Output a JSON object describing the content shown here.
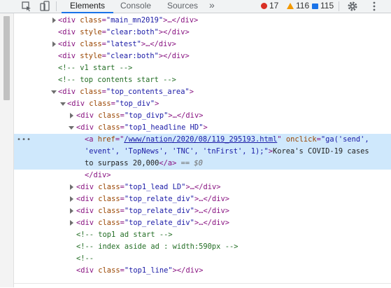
{
  "toolbar": {
    "tabs": [
      "Elements",
      "Console",
      "Sources"
    ],
    "more": "»",
    "errors": "17",
    "warnings": "116",
    "messages": "115",
    "colors": {
      "error": "#d93025",
      "warning": "#f29900",
      "message": "#1a73e8",
      "tab_underline": "#1a73e8"
    }
  },
  "dom": {
    "l1": {
      "open": "<div",
      "attr": "class",
      "val": "\"main_mn2019\"",
      "rest": ">…</div>"
    },
    "l2": {
      "open": "<div",
      "attr": "style",
      "val": "\"clear:both\"",
      "rest": "></div>"
    },
    "l3": {
      "open": "<div",
      "attr": "class",
      "val": "\"latest\"",
      "rest": ">…</div>"
    },
    "l4": {
      "open": "<div",
      "attr": "style",
      "val": "\"clear:both\"",
      "rest": "></div>"
    },
    "l5": {
      "comment": "<!-- v1 start -->"
    },
    "l6": {
      "comment": "<!-- top contents start -->"
    },
    "l7": {
      "open": "<div",
      "attr": "class",
      "val": "\"top_contents_area\"",
      "rest": ">"
    },
    "l8": {
      "open": "<div",
      "attr": "class",
      "val": "\"top_div\"",
      "rest": ">"
    },
    "l9": {
      "open": "<div",
      "attr": "class",
      "val": "\"top_divp\"",
      "rest": ">…</div>"
    },
    "l10": {
      "open": "<div",
      "attr": "class",
      "val": "\"top1_headline HD\"",
      "rest": ">"
    },
    "l11": {
      "dots": "•••",
      "open": "<a",
      "href_attr": "href",
      "eq1": "=\"",
      "href_val": "/www/nation/2020/08/119_295193.html",
      "q1": "\"",
      "onclick_attr": "onclick",
      "eq2": "=",
      "onclick_val_a": "\"ga('send',",
      "onclick_val_b": "'event', 'TopNews', 'TNC', 'tnFirst', 1);\"",
      "close1": ">",
      "text_a": "Korea's COVID-19 cases",
      "text_b": "to surpass 20,000",
      "close_a": "</a>",
      "eqeq": " == ",
      "dollar": "$0"
    },
    "l12": {
      "close": "</div>"
    },
    "l13": {
      "open": "<div",
      "attr": "class",
      "val": "\"top1_lead LD\"",
      "rest": ">…</div>"
    },
    "l14": {
      "open": "<div",
      "attr": "class",
      "val": "\"top_relate_div\"",
      "rest": ">…</div>"
    },
    "l15": {
      "open": "<div",
      "attr": "class",
      "val": "\"top_relate_div\"",
      "rest": ">…</div>"
    },
    "l16": {
      "open": "<div",
      "attr": "class",
      "val": "\"top_relate_div\"",
      "rest": ">…</div>"
    },
    "l17": {
      "comment": "<!-- top1 ad start -->"
    },
    "l18": {
      "comment": "<!-- index aside ad : width:590px -->"
    },
    "l19": {
      "comment": "<!--"
    },
    "l20": {
      "open": "<div",
      "attr": "class",
      "val": "\"top1_line\"",
      "rest": "></div>"
    }
  }
}
